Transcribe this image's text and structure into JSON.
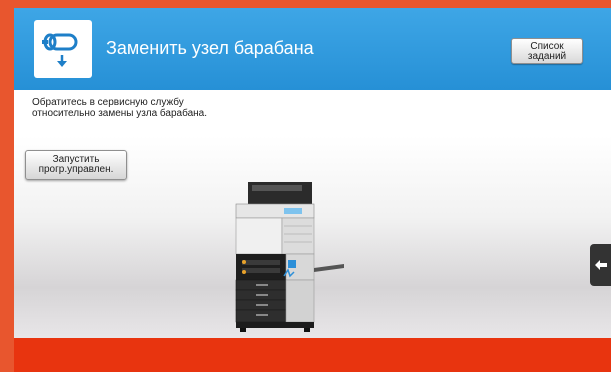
{
  "header": {
    "title": "Заменить узел барабана",
    "icon": "drum-unit-icon",
    "jobs_button": {
      "line1": "Список",
      "line2": "заданий"
    }
  },
  "message": {
    "line1": "Обратитесь в сервисную службу",
    "line2": "относительно замены узла барабана."
  },
  "main": {
    "remote_button": {
      "line1": "Запустить",
      "line2": "прогр.управлен."
    },
    "device_image": "mfp-printer-illustration",
    "side_tab_icon": "arrow-left-icon"
  },
  "colors": {
    "header_blue": "#2a95da",
    "accent_orange": "#e8562e",
    "bottom_red": "#e8340f"
  }
}
